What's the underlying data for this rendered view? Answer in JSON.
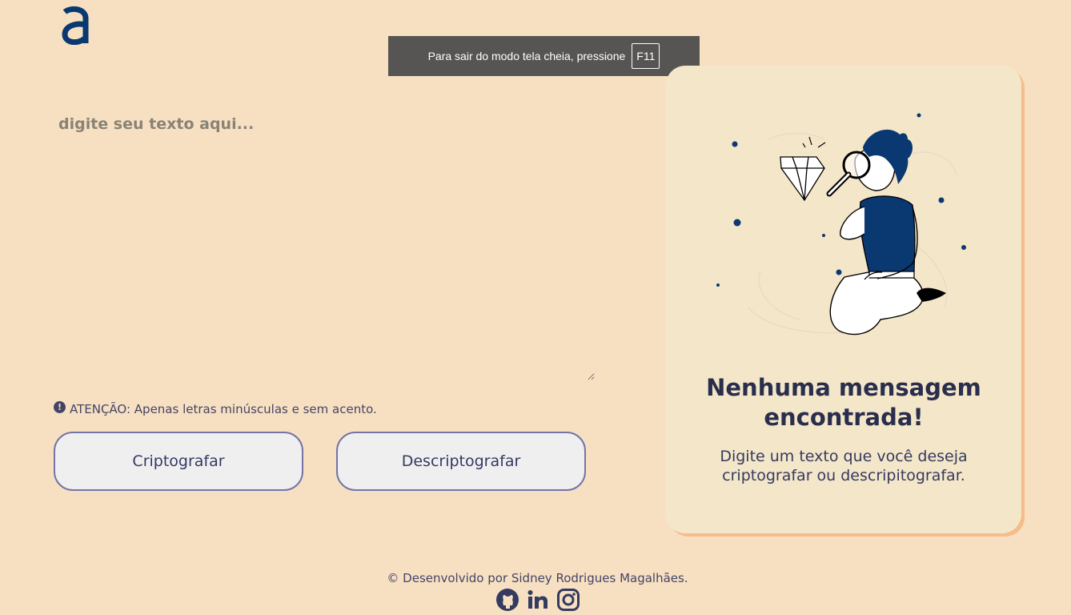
{
  "fullscreen_notice": {
    "text": "Para sair do modo tela cheia, pressione",
    "key": "F11"
  },
  "editor": {
    "placeholder": "digite seu texto aqui..."
  },
  "warning": {
    "text": "ATENÇÃO: Apenas letras minúsculas e sem acento."
  },
  "buttons": {
    "encrypt": "Criptografar",
    "decrypt": "Descriptografar"
  },
  "output_panel": {
    "title": "Nenhuma mensagem encontrada!",
    "description": "Digite um texto que você deseja criptografar ou descripitografar."
  },
  "footer": {
    "credit": "© Desenvolvido por Sidney Rodrigues Magalhães.",
    "social_icons": [
      "github-icon",
      "linkedin-icon",
      "instagram-icon"
    ]
  },
  "colors": {
    "background": "#f7e0c2",
    "brand_blue": "#0a3871",
    "panel": "#f4e6c9",
    "panel_shadow": "#f5bd8a",
    "button_border": "#7474a8"
  }
}
